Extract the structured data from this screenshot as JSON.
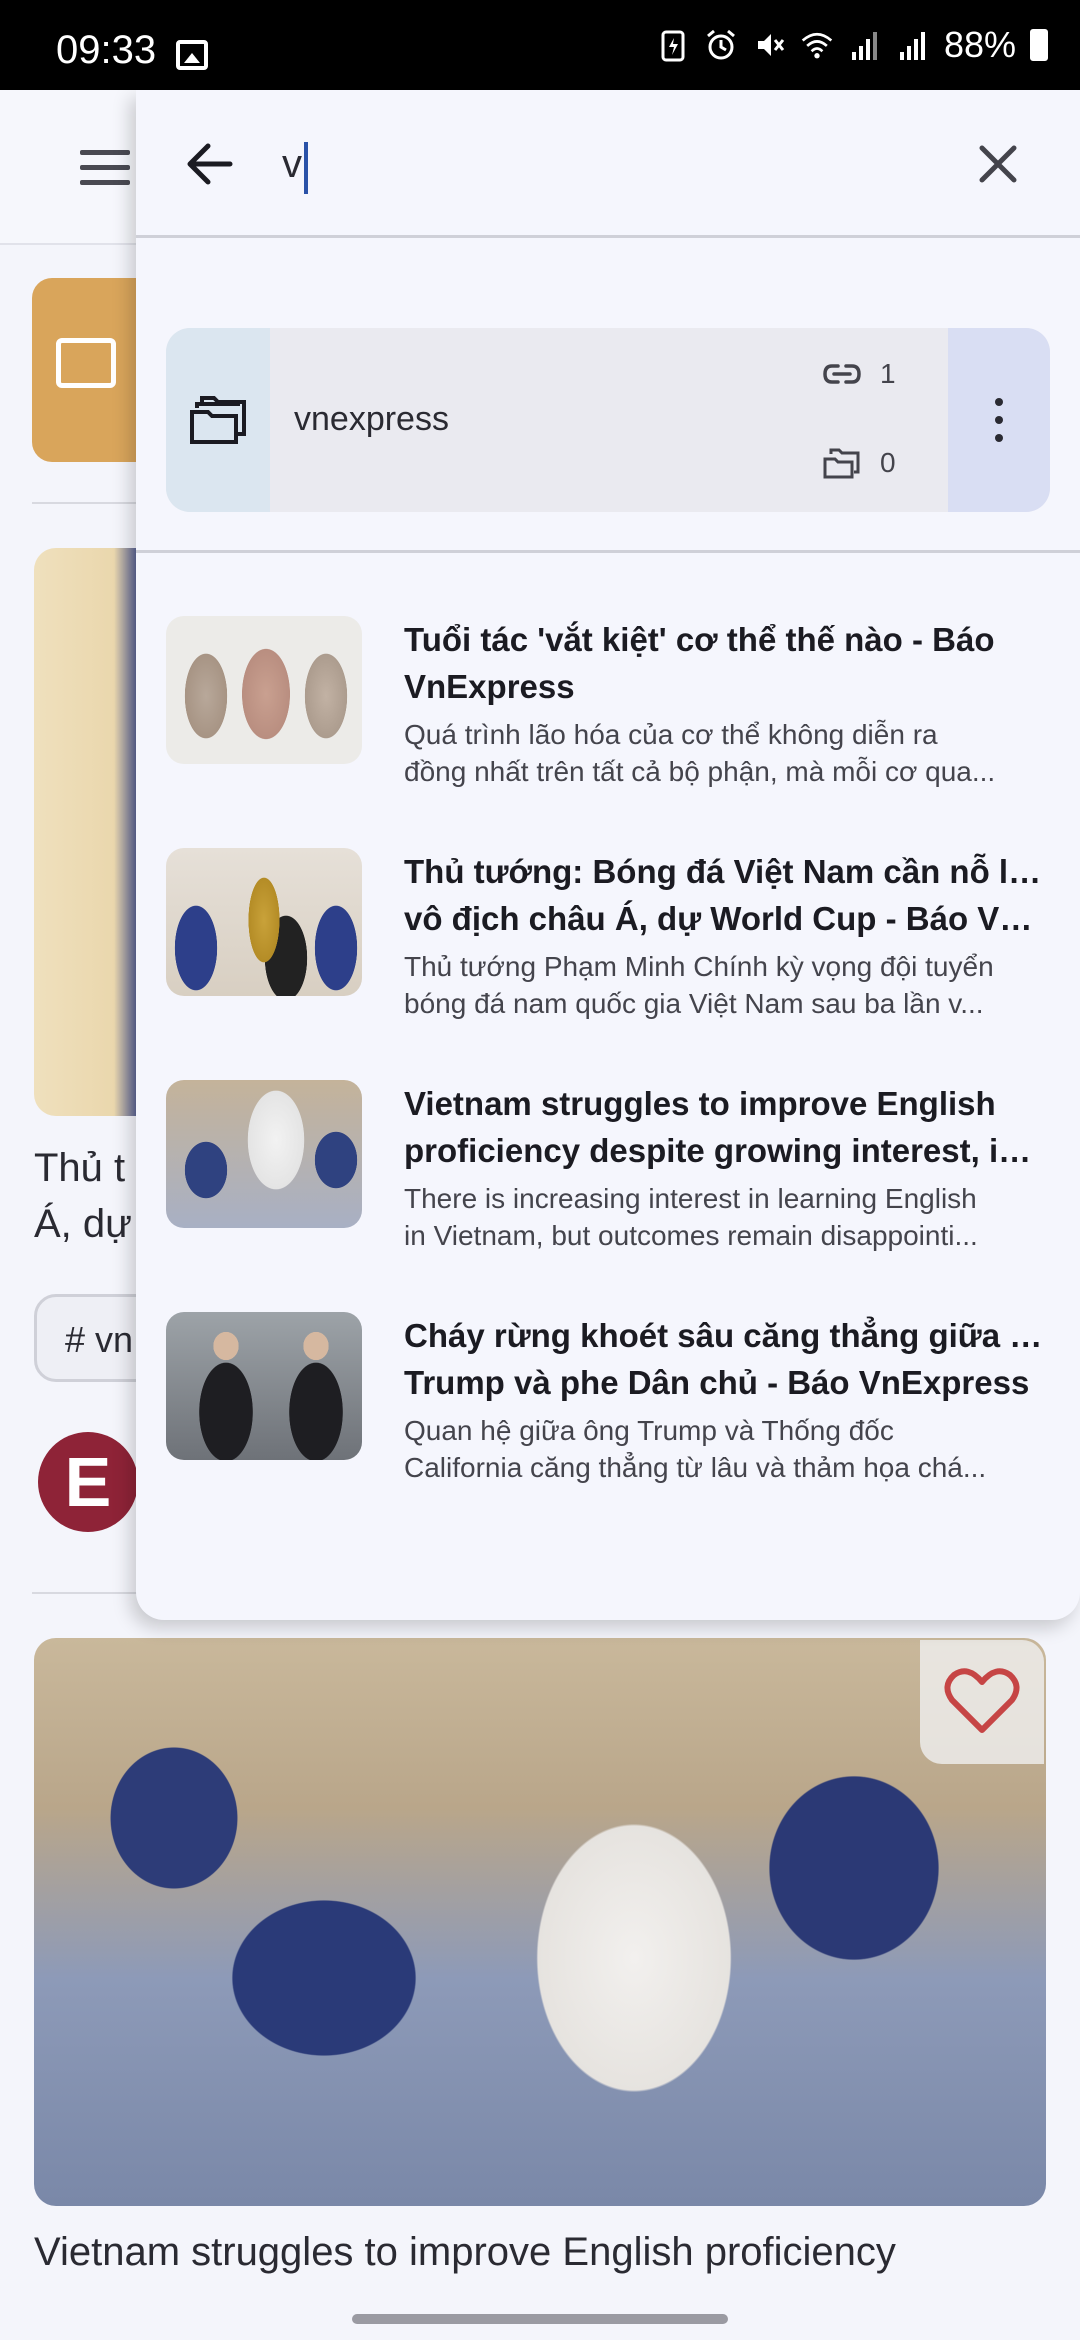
{
  "status_bar": {
    "time": "09:33",
    "battery": "88%"
  },
  "search": {
    "query": "v",
    "back_icon": "arrow-left-icon",
    "close_icon": "close-icon"
  },
  "folder_result": {
    "name": "vnexpress",
    "links_count": "1",
    "subfolders_count": "0"
  },
  "link_results": [
    {
      "title_line1": "Tuổi tác 'vắt kiệt' cơ thể thế nào - Báo",
      "title_line2": "VnExpress",
      "desc_line1": "Quá trình lão hóa của cơ thể không diễn ra",
      "desc_line2": "đồng nhất trên tất cả bộ phận, mà mỗi cơ qua..."
    },
    {
      "title_line1": "Thủ tướng: Bóng đá Việt Nam cần nỗ lực",
      "title_line2": "vô địch châu Á, dự World Cup - Báo Vn...",
      "desc_line1": "Thủ tướng Phạm Minh Chính kỳ vọng đội tuyển",
      "desc_line2": "bóng đá nam quốc gia Việt Nam sau ba lần v..."
    },
    {
      "title_line1": "Vietnam struggles to improve English",
      "title_line2": "proficiency despite growing interest, inv...",
      "desc_line1": "There is increasing interest in learning English",
      "desc_line2": "in Vietnam, but outcomes remain disappointi..."
    },
    {
      "title_line1": "Cháy rừng khoét sâu căng thẳng giữa ông",
      "title_line2": "Trump và phe Dân chủ - Báo VnExpress",
      "desc_line1": "Quan hệ giữa ông Trump và Thống đốc",
      "desc_line2": "California căng thẳng từ lâu và thảm họa chá..."
    }
  ],
  "background": {
    "card1_title_line1": "Thủ t",
    "card1_title_line2": "Á, dự",
    "card1_tag": "# vn",
    "card1_avatar_letter": "E",
    "card2_title": "Vietnam struggles to improve English proficiency"
  }
}
